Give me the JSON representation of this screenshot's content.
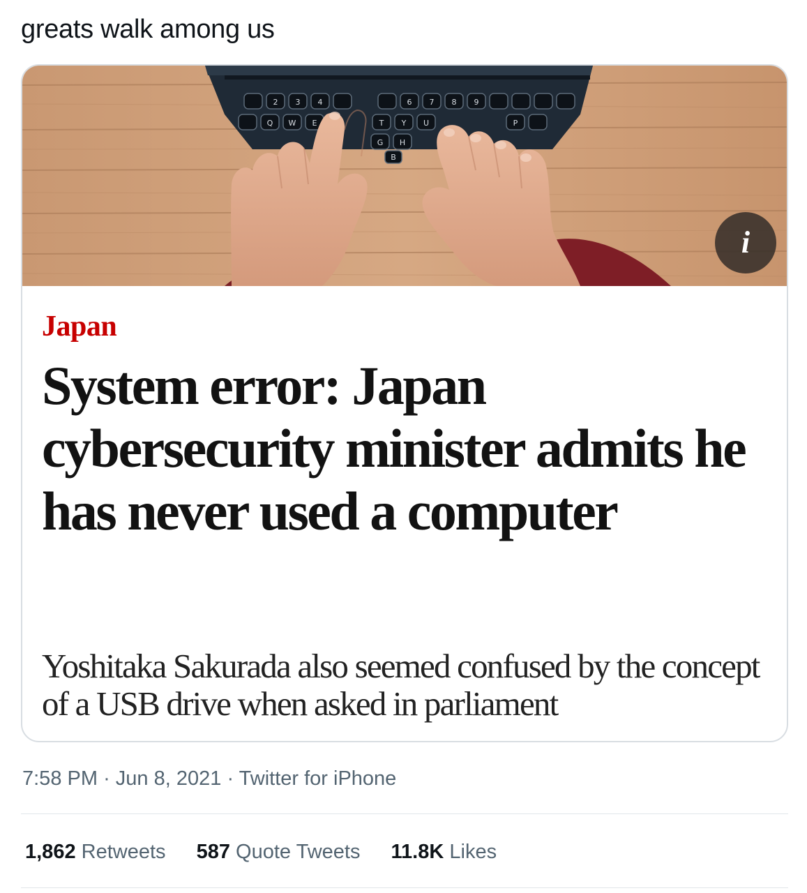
{
  "tweet": {
    "text": "greats walk among us",
    "meta": {
      "time": "7:58 PM",
      "date": "Jun 8, 2021",
      "source": "Twitter for iPhone",
      "separator": "·"
    },
    "stats": [
      {
        "count": "1,862",
        "label": "Retweets"
      },
      {
        "count": "587",
        "label": "Quote Tweets"
      },
      {
        "count": "11.8K",
        "label": "Likes"
      }
    ]
  },
  "card": {
    "image_icon": "typewriter-hands-photo",
    "info_badge": "i",
    "section": "Japan",
    "headline": "System error: Japan cybersecurity minister admits he has never used a computer",
    "standfirst": "Yoshitaka Sakurada also seemed confused by the concept of a USB drive when asked in parliament",
    "colors": {
      "section": "#c70000",
      "headline": "#121212",
      "border": "#d8dde2"
    }
  }
}
